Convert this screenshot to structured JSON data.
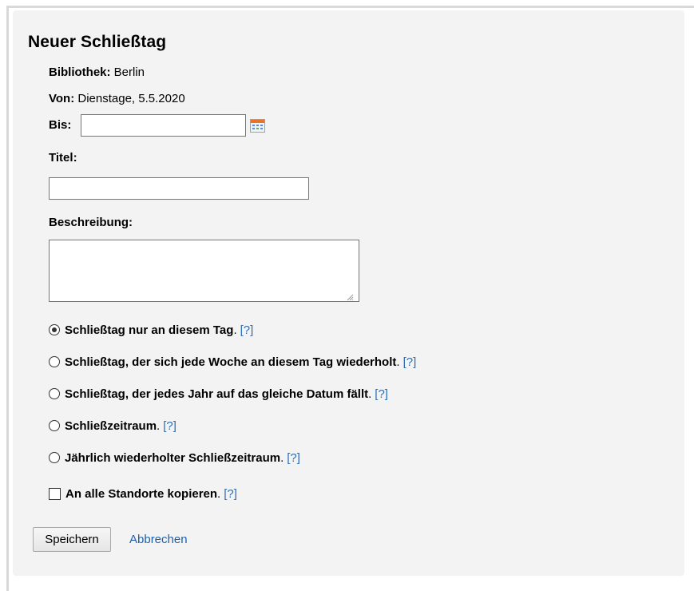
{
  "form": {
    "title": "Neuer Schließtag",
    "library_label": "Bibliothek:",
    "library_value": "Berlin",
    "from_label": "Von:",
    "from_value": "Dienstage, 5.5.2020",
    "to_label": "Bis:",
    "to_value": "",
    "title_label": "Titel:",
    "title_value": "",
    "description_label": "Beschreibung:",
    "description_value": ""
  },
  "options": [
    {
      "label": "Schließtag nur an diesem Tag",
      "checked": true,
      "help": "[?]"
    },
    {
      "label": "Schließtag, der sich jede Woche an diesem Tag wiederholt",
      "checked": false,
      "help": "[?]"
    },
    {
      "label": "Schließtag, der jedes Jahr auf das gleiche Datum fällt",
      "checked": false,
      "help": "[?]"
    },
    {
      "label": "Schließzeitraum",
      "checked": false,
      "help": "[?]"
    },
    {
      "label": "Jährlich wiederholter Schließzeitraum",
      "checked": false,
      "help": "[?]"
    }
  ],
  "copy_option": {
    "label": "An alle Standorte kopieren",
    "checked": false,
    "help": "[?]"
  },
  "punctuation": ".",
  "actions": {
    "save_label": "Speichern",
    "cancel_label": "Abbrechen"
  },
  "icons": {
    "calendar": "calendar-icon"
  }
}
